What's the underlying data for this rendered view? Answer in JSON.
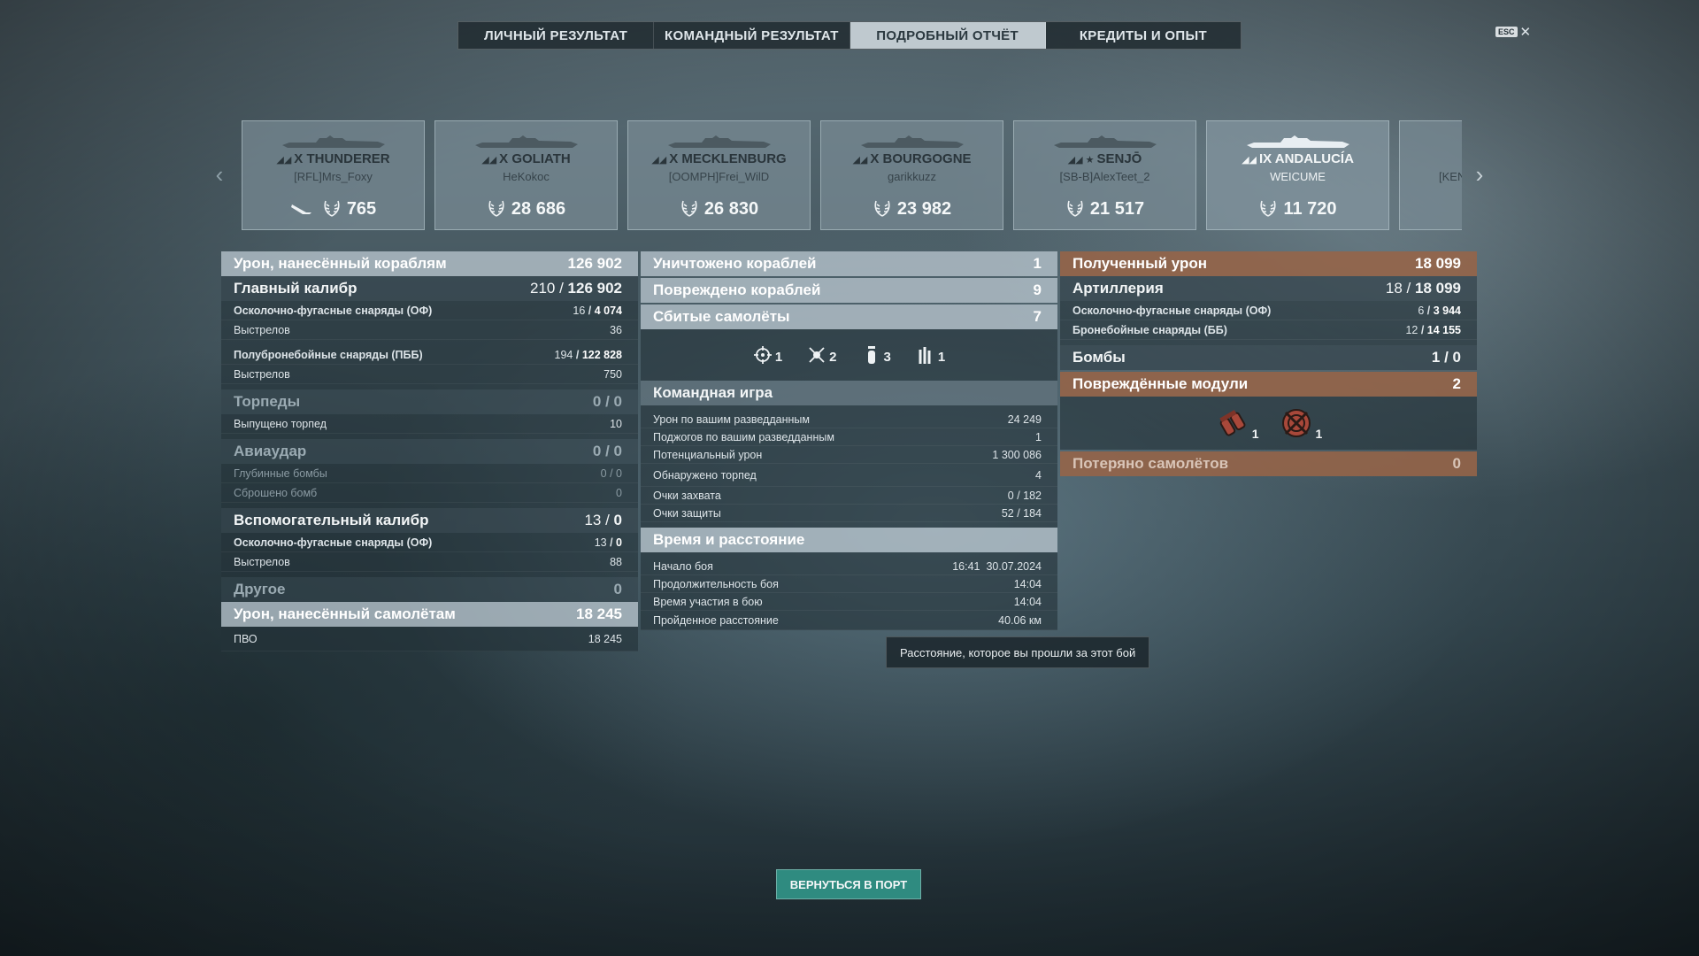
{
  "tabs": [
    "ЛИЧНЫЙ РЕЗУЛЬТАТ",
    "КОМАНДНЫЙ РЕЗУЛЬТАТ",
    "ПОДРОБНЫЙ ОТЧЁТ",
    "КРЕДИТЫ И ОПЫТ"
  ],
  "active_tab": 2,
  "esc_label": "ESC",
  "close_glyph": "✕",
  "cards": [
    {
      "ship": "X THUNDERER",
      "player": "[RFL]Mrs_Foxy",
      "score": "765",
      "plane_icon": true
    },
    {
      "ship": "X GOLIATH",
      "player": "HeKokoc",
      "score": "28 686"
    },
    {
      "ship": "X MECKLENBURG",
      "player": "[OOMPH]Frei_WilD",
      "score": "26 830"
    },
    {
      "ship": "X BOURGOGNE",
      "player": "garikkuzz",
      "score": "23 982"
    },
    {
      "ship": "SENJŌ",
      "player": "[SB-B]AlexTeet_2",
      "score": "21 517",
      "star": true
    },
    {
      "ship": "IX ANDALUCÍA",
      "player": "WEICUME",
      "score": "11 720",
      "me": true
    },
    {
      "ship": "",
      "player": "[KEN",
      "score": "",
      "partial": true
    }
  ],
  "left": {
    "ship_damage": {
      "label": "Урон, нанесённый кораблям",
      "value": "126 902"
    },
    "main_battery": {
      "label": "Главный калибр",
      "value_a": "210",
      "value_b": "126 902"
    },
    "he_shells": {
      "label": "Осколочно-фугасные снаряды (ОФ)",
      "value_a": "16",
      "value_b": "4 074"
    },
    "he_shots": {
      "label": "Выстрелов",
      "value": "36"
    },
    "sap_shells": {
      "label": "Полубронебойные снаряды (ПББ)",
      "value_a": "194",
      "value_b": "122 828"
    },
    "sap_shots": {
      "label": "Выстрелов",
      "value": "750"
    },
    "torpedoes": {
      "label": "Торпеды",
      "value": "0 / 0"
    },
    "torps_launched": {
      "label": "Выпущено торпед",
      "value": "10"
    },
    "airstrike": {
      "label": "Авиаудар",
      "value": "0 / 0"
    },
    "depth_charges": {
      "label": "Глубинные бомбы",
      "value": "0 / 0"
    },
    "bombs_dropped": {
      "label": "Сброшено бомб",
      "value": "0"
    },
    "secondary": {
      "label": "Вспомогательный калибр",
      "value_a": "13",
      "value_b": "0"
    },
    "sec_he": {
      "label": "Осколочно-фугасные снаряды (ОФ)",
      "value_a": "13",
      "value_b": "0"
    },
    "sec_shots": {
      "label": "Выстрелов",
      "value": "88"
    },
    "other": {
      "label": "Другое",
      "value": "0"
    },
    "plane_damage": {
      "label": "Урон, нанесённый самолётам",
      "value": "18 245"
    },
    "aa": {
      "label": "ПВО",
      "value": "18 245"
    }
  },
  "middle": {
    "destroyed": {
      "label": "Уничтожено кораблей",
      "value": "1"
    },
    "damaged": {
      "label": "Повреждено кораблей",
      "value": "9"
    },
    "planes_shot": {
      "label": "Сбитые самолёты",
      "value": "7"
    },
    "plane_types": [
      {
        "icon": "crosshair-plane-icon",
        "count": "1"
      },
      {
        "icon": "fighter-plane-icon",
        "count": "2"
      },
      {
        "icon": "bomber-plane-icon",
        "count": "3"
      },
      {
        "icon": "rocket-plane-icon",
        "count": "1"
      }
    ],
    "teamplay": {
      "label": "Командная игра"
    },
    "spot_damage": {
      "label": "Урон по вашим разведданным",
      "value": "24 249"
    },
    "spot_fires": {
      "label": "Поджогов по вашим разведданным",
      "value": "1"
    },
    "potential": {
      "label": "Потенциальный урон",
      "value": "1 300 086"
    },
    "torps_spotted": {
      "label": "Обнаружено торпед",
      "value": "4"
    },
    "capture": {
      "label": "Очки захвата",
      "value": "0 / 182"
    },
    "defense": {
      "label": "Очки защиты",
      "value": "52 / 184"
    },
    "time_dist": {
      "label": "Время и расстояние"
    },
    "start": {
      "label": "Начало боя",
      "time": "16:41",
      "date": "30.07.2024"
    },
    "duration": {
      "label": "Продолжительность боя",
      "value": "14:04"
    },
    "participation": {
      "label": "Время участия в бою",
      "value": "14:04"
    },
    "distance": {
      "label": "Пройденное расстояние",
      "value": "40.06 км"
    },
    "tooltip": "Расстояние, которое вы прошли за этот бой"
  },
  "right": {
    "received": {
      "label": "Полученный урон",
      "value": "18 099"
    },
    "artillery": {
      "label": "Артиллерия",
      "value_a": "18",
      "value_b": "18 099"
    },
    "he": {
      "label": "Осколочно-фугасные снаряды (ОФ)",
      "value_a": "6",
      "value_b": "3 944"
    },
    "ap": {
      "label": "Бронебойные снаряды (ББ)",
      "value_a": "12",
      "value_b": "14 155"
    },
    "bombs": {
      "label": "Бомбы",
      "value": "1 / 0"
    },
    "modules": {
      "label": "Повреждённые модули",
      "value": "2"
    },
    "module_items": [
      {
        "icon": "engine-module-icon",
        "count": "1"
      },
      {
        "icon": "steering-module-icon",
        "count": "1"
      }
    ],
    "planes_lost": {
      "label": "Потеряно самолётов",
      "value": "0"
    }
  },
  "back_button": "ВЕРНУТЬСЯ В ПОРТ",
  "colors": {
    "accent_button": "#2f8b80",
    "received_header": "#96644a",
    "active_tab": "#bfc9cf"
  }
}
